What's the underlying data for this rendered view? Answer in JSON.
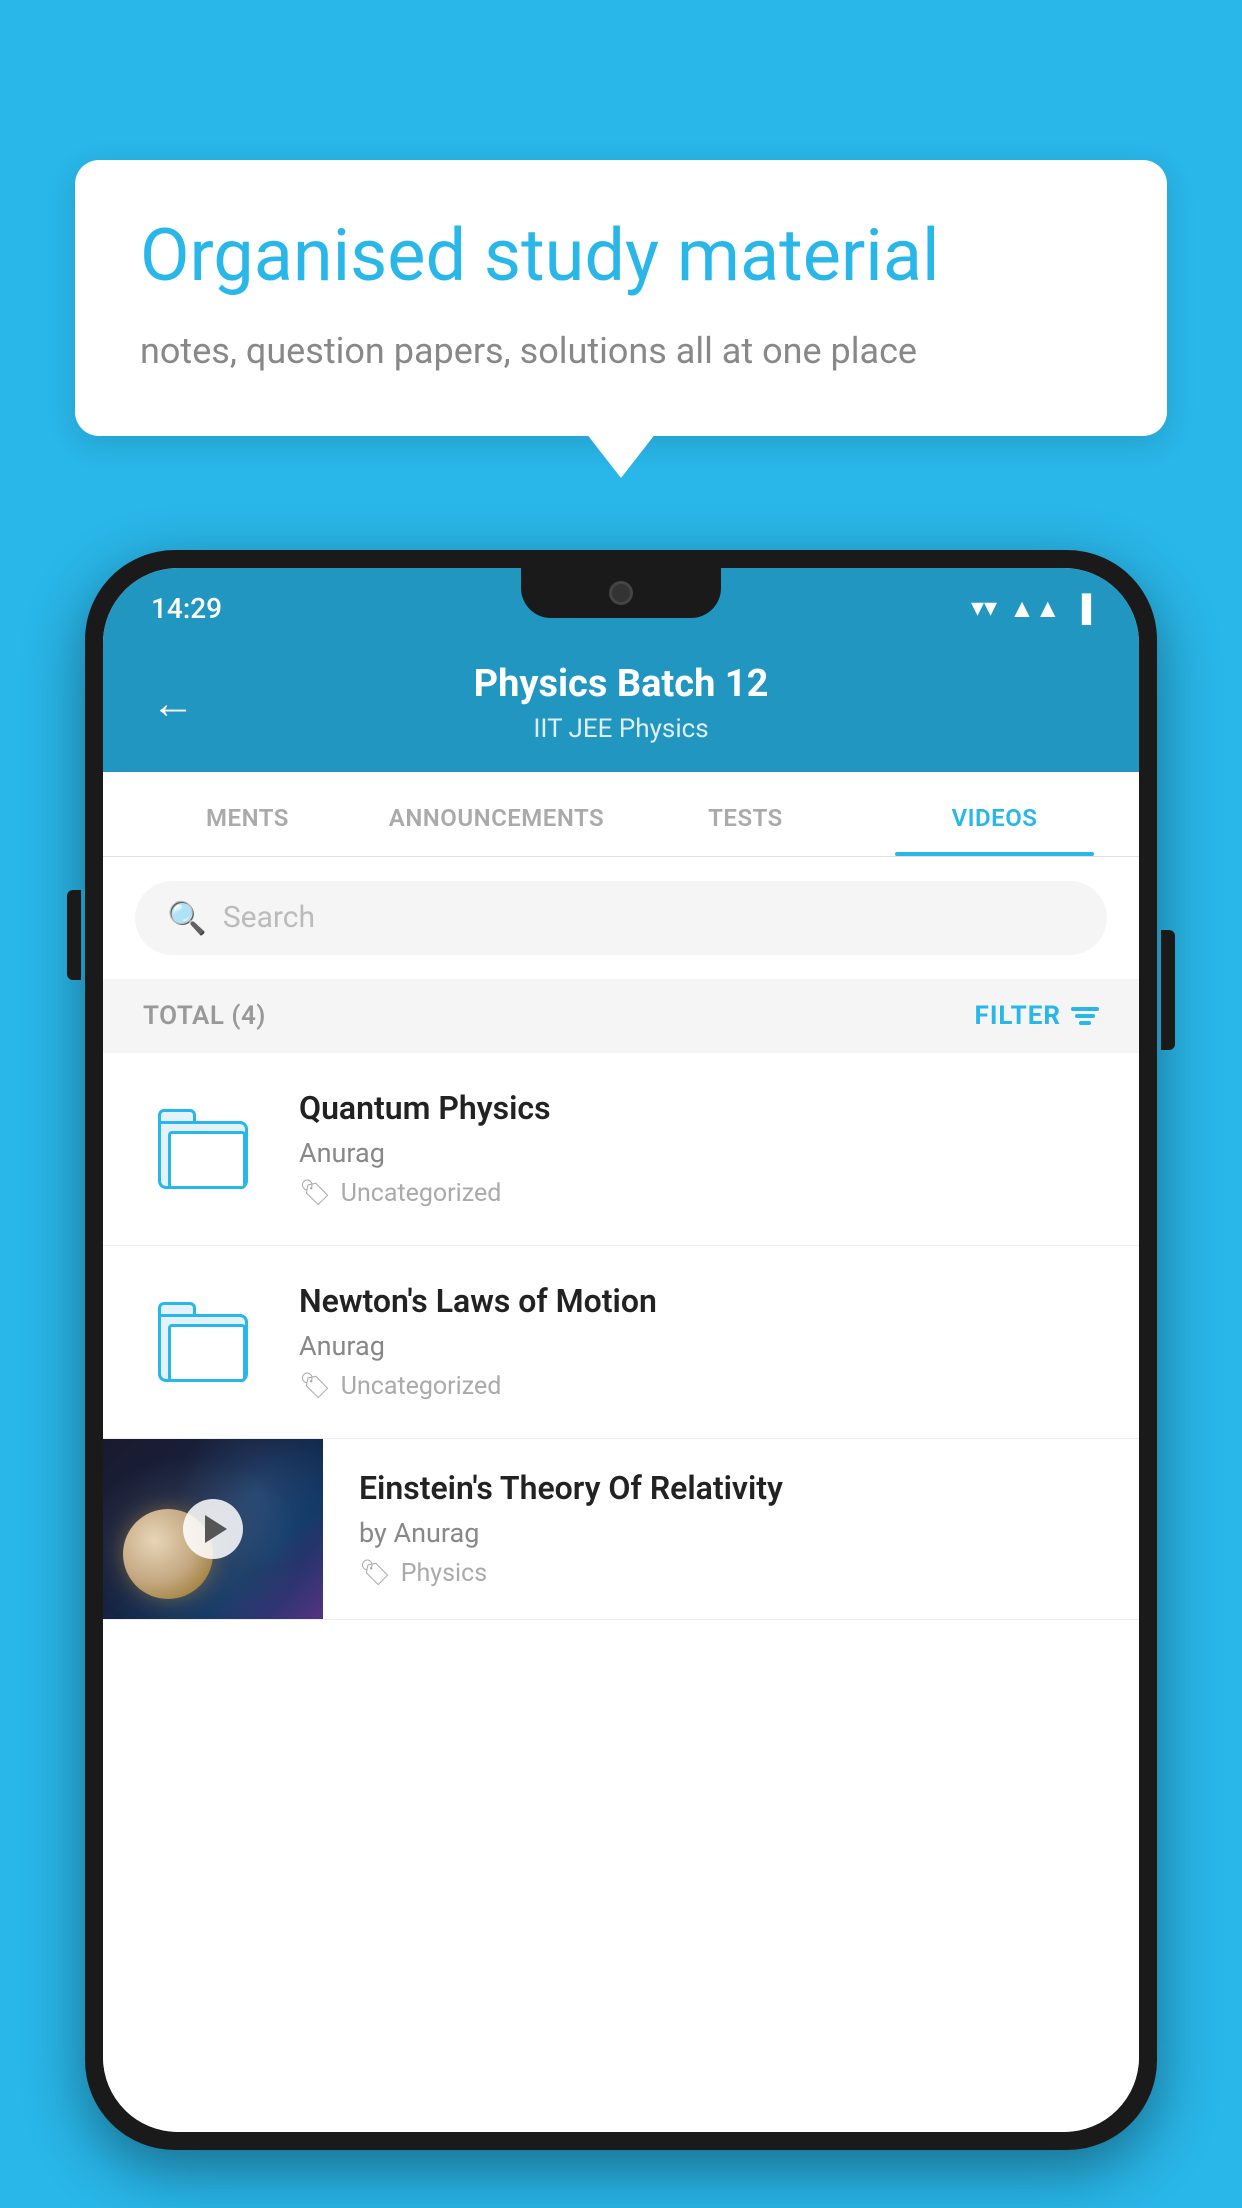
{
  "background_color": "#29B6E8",
  "bubble": {
    "heading": "Organised study material",
    "subtext": "notes, question papers, solutions all at one place"
  },
  "status_bar": {
    "time": "14:29",
    "wifi": "▼",
    "signal": "▲",
    "battery": "▐"
  },
  "header": {
    "title": "Physics Batch 12",
    "subtitle": "IIT JEE   Physics",
    "back_label": "←"
  },
  "tabs": [
    {
      "label": "MENTS",
      "active": false
    },
    {
      "label": "ANNOUNCEMENTS",
      "active": false
    },
    {
      "label": "TESTS",
      "active": false
    },
    {
      "label": "VIDEOS",
      "active": true
    }
  ],
  "search": {
    "placeholder": "Search"
  },
  "filter_row": {
    "total_label": "TOTAL (4)",
    "filter_label": "FILTER"
  },
  "videos": [
    {
      "title": "Quantum Physics",
      "author": "Anurag",
      "tag": "Uncategorized",
      "type": "folder"
    },
    {
      "title": "Newton's Laws of Motion",
      "author": "Anurag",
      "tag": "Uncategorized",
      "type": "folder"
    },
    {
      "title": "Einstein's Theory Of Relativity",
      "author": "by Anurag",
      "tag": "Physics",
      "type": "video"
    }
  ]
}
